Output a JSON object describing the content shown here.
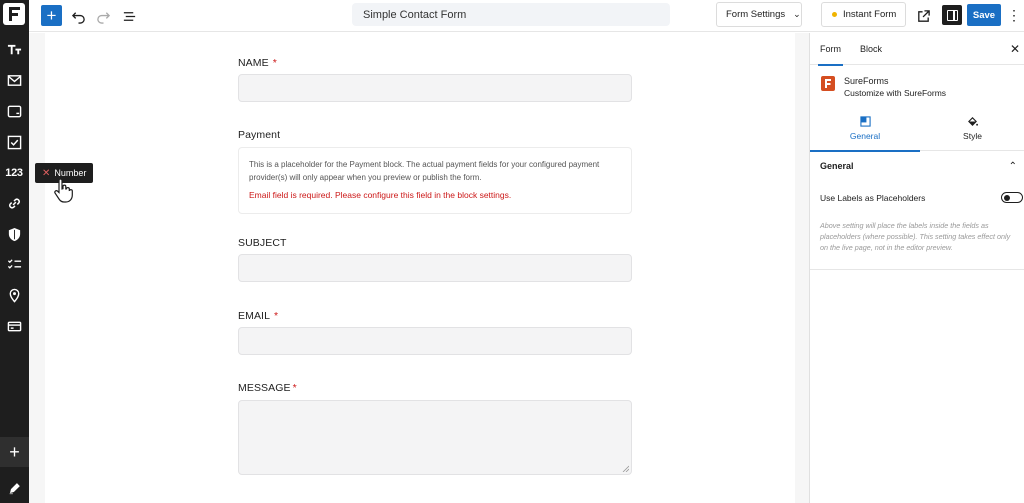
{
  "topbar": {
    "insert_symbol": "+",
    "form_title": "Simple Contact Form",
    "form_settings_label": "Form Settings",
    "instant_form_label": "Instant Form",
    "save_label": "Save"
  },
  "rail": {
    "items": [
      "text-format-icon",
      "envelope-icon",
      "input-icon",
      "checkbox-icon",
      "123",
      "link-icon",
      "shield-icon",
      "checklist-icon",
      "location-icon",
      "payment-card-icon"
    ]
  },
  "tooltip": {
    "label": "Number"
  },
  "form": {
    "name_label": "NAME",
    "required_mark": "*",
    "payment_label": "Payment",
    "payment_placeholder": "This is a placeholder for the Payment block. The actual payment fields for your configured payment provider(s) will only appear when you preview or publish the form.",
    "payment_error": "Email field is required. Please configure this field in the block settings.",
    "subject_label": "SUBJECT",
    "email_label": "EMAIL",
    "message_label": "MESSAGE"
  },
  "sidebar": {
    "tabs": [
      "Form",
      "Block"
    ],
    "plugin_name": "SureForms",
    "plugin_desc": "Customize with SureForms",
    "sub_tabs": [
      "General",
      "Style"
    ],
    "section_title": "General",
    "toggle_label": "Use Labels as Placeholders",
    "help_text": "Above setting will place the labels inside the fields as placeholders (where possible). This setting takes effect only on the live page, not in the editor preview."
  },
  "colors": {
    "accent": "#1a6fc4",
    "dark": "#1e1e1e",
    "error": "#cc1818",
    "brand": "#d54e21"
  }
}
